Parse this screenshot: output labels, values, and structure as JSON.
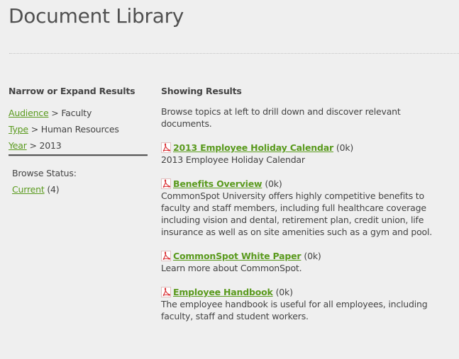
{
  "page": {
    "title": "Document Library"
  },
  "sidebar": {
    "heading": "Narrow or Expand Results",
    "filters": [
      {
        "label": "Audience",
        "separator": ">",
        "value": "Faculty"
      },
      {
        "label": "Type",
        "separator": ">",
        "value": "Human Resources"
      },
      {
        "label": "Year",
        "separator": ">",
        "value": "2013"
      }
    ],
    "browse_status": {
      "label": "Browse Status:",
      "link": "Current",
      "count": "(4)"
    }
  },
  "main": {
    "heading": "Showing Results",
    "intro": "Browse topics at left to drill down and discover relevant documents.",
    "results": [
      {
        "icon": "pdf-icon",
        "title": "2013 Employee Holiday Calendar",
        "size": "(0k)",
        "description": "2013 Employee Holiday Calendar"
      },
      {
        "icon": "pdf-icon",
        "title": "Benefits Overview",
        "size": "(0k)",
        "description": "CommonSpot University offers highly competitive benefits to faculty and staff members, including full healthcare coverage including vision and dental, retirement plan, credit union, life insurance as well as on site amenities such as a gym and pool."
      },
      {
        "icon": "pdf-icon",
        "title": "CommonSpot White Paper",
        "size": "(0k)",
        "description": "Learn more about CommonSpot."
      },
      {
        "icon": "pdf-icon",
        "title": "Employee Handbook",
        "size": "(0k)",
        "description": "The employee handbook is useful for all employees, including faculty, staff and student workers."
      }
    ]
  },
  "colors": {
    "background": "#efefef",
    "link": "#5a9a1e",
    "text": "#444444",
    "pdf_icon": "#d9262b"
  }
}
